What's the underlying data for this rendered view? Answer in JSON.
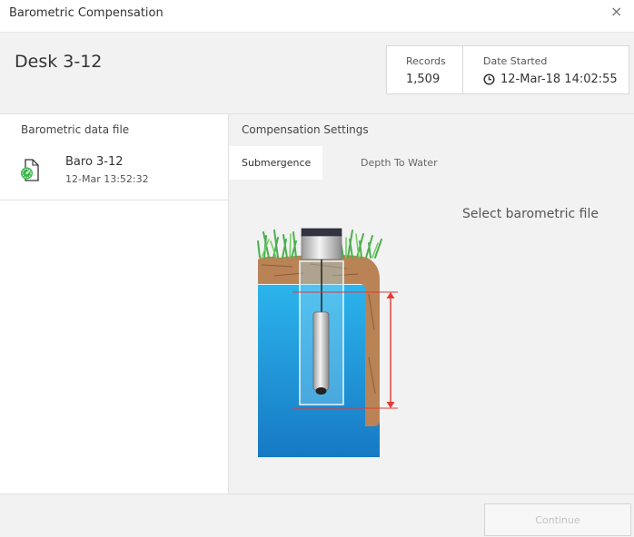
{
  "window": {
    "title": "Barometric Compensation",
    "close_glyph": "×"
  },
  "device": {
    "name": "Desk 3-12"
  },
  "stats": {
    "records_label": "Records",
    "records_value": "1,509",
    "date_label": "Date Started",
    "date_value": "12-Mar-18 14:02:55"
  },
  "baro": {
    "heading": "Barometric data file",
    "item": {
      "name": "Baro 3-12",
      "time": "12-Mar 13:52:32",
      "icon": "barometric-file-icon"
    }
  },
  "compensation": {
    "heading": "Compensation Settings",
    "tabs": [
      {
        "label": "Submergence",
        "active": true
      },
      {
        "label": "Depth To Water",
        "active": false
      }
    ],
    "hint": "Select barometric file",
    "diagram_icon": "well-submergence-diagram"
  },
  "footer": {
    "continue_label": "Continue",
    "continue_enabled": false
  },
  "colors": {
    "water": "#1aa3e0",
    "grass": "#4caf50",
    "soil": "#b07a52",
    "measure_line": "#e53935",
    "baro_icon": "#3bb44a"
  }
}
